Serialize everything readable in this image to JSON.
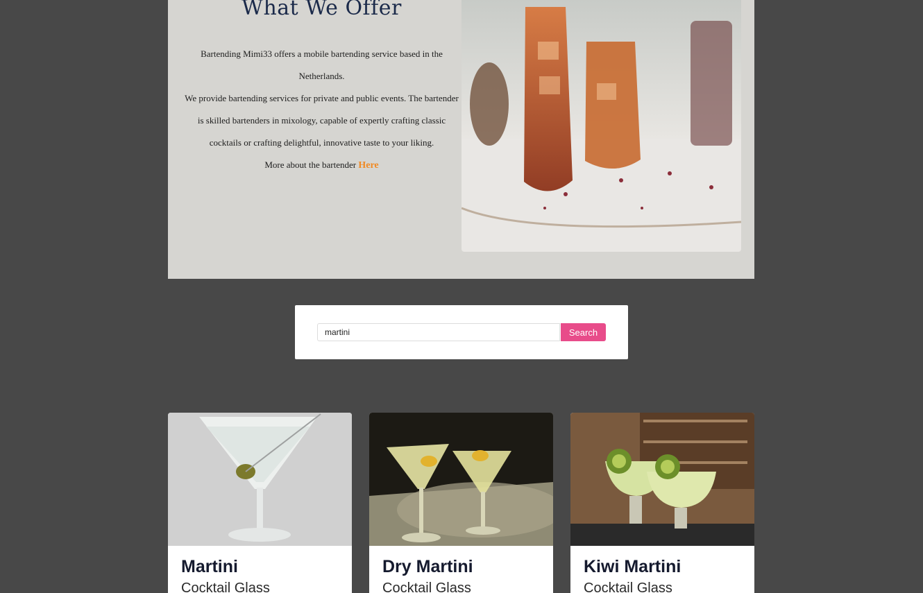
{
  "offer": {
    "title": "What We Offer",
    "paragraph1": "Bartending Mimi33 offers a mobile bartending service based in the Netherlands.",
    "paragraph2": "We provide bartending services for private and public events. The bartender is skilled bartenders in mixology, capable of expertly crafting classic cocktails or crafting delightful, innovative taste to your liking.",
    "more_prefix": "More about the bartender",
    "more_link": "Here"
  },
  "search": {
    "value": "martini",
    "button_label": "Search"
  },
  "results": [
    {
      "name": "Martini",
      "glass": "Cocktail Glass"
    },
    {
      "name": "Dry Martini",
      "glass": "Cocktail Glass"
    },
    {
      "name": "Kiwi Martini",
      "glass": "Cocktail Glass"
    }
  ],
  "colors": {
    "page_background": "#484848",
    "hero_background": "#d6d5d1",
    "accent": "#e84c8a",
    "link": "#f08a24"
  }
}
